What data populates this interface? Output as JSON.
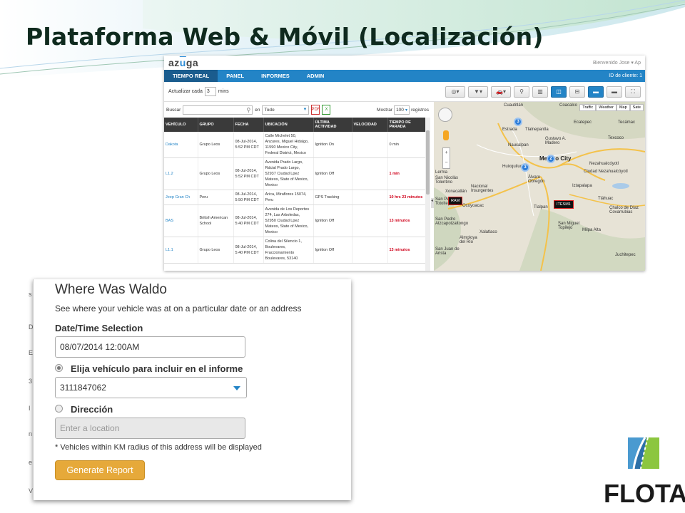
{
  "slide": {
    "title": "Plataforma Web & Móvil (Localización)"
  },
  "app": {
    "logo": "azuga",
    "welcome": "Bienvenido Jose ▾   Ap",
    "nav": [
      "TIEMPO REAL",
      "PANEL",
      "INFORMES",
      "ADMIN"
    ],
    "client_label": "ID de cliente: 1",
    "refresh": {
      "label": "Actualizar cada",
      "value": "3",
      "unit": "mins"
    },
    "search": {
      "label": "Buscar",
      "in_label": "en",
      "scope": "Todo",
      "show_label": "Mostrar",
      "show_value": "100",
      "records_label": "registros"
    },
    "table": {
      "headers": [
        "VEHÍCULO",
        "GRUPO",
        "FECHA",
        "UBICACIÓN",
        "ÚLTIMA ACTIVIDAD",
        "VELOCIDAD",
        "TIEMPO DE PARADA"
      ],
      "rows": [
        {
          "vehicle": "Dakota",
          "group": "Grupo Leos",
          "date": "08-Jul-2014, 5:52 PM CDT",
          "location": "Calle Michelet 50, Anzures, Miguel Hidalgo, 11590 Mexico City, Federal District, Mexico",
          "activity": "Ignition On",
          "speed": "",
          "stop": "0 min",
          "stop_red": false
        },
        {
          "vehicle": "L1.2",
          "group": "Grupo Leos",
          "date": "08-Jul-2014, 5:52 PM CDT",
          "location": "Avenida Prado Largo, Rdcial Prado Largo, 52937 Ciudad Lpez Mateos, State of Mexico, Mexico",
          "activity": "Ignition Off",
          "speed": "",
          "stop": "1 min",
          "stop_red": true
        },
        {
          "vehicle": "Jeep Gran Ch",
          "group": "Peru",
          "date": "08-Jul-2014, 5:50 PM CDT",
          "location": "Arica, Miraflores 15074, Peru",
          "activity": "GPS Tracking",
          "speed": "",
          "stop": "10 hrs 23 minutos",
          "stop_red": true
        },
        {
          "vehicle": "BAS",
          "group": "British American School",
          "date": "08-Jul-2014, 5:40 PM CDT",
          "location": "Avenida de Los Deportes 274, Las Arboledas, 52950 Ciudad Lpez Mateos, State of Mexico, Mexico",
          "activity": "Ignition Off",
          "speed": "",
          "stop": "13 minutos",
          "stop_red": true
        },
        {
          "vehicle": "L1.1",
          "group": "Grupo Leos",
          "date": "08-Jul-2014, 5:40 PM CDT",
          "location": "Colina del Silencio 1, Boulevares, Fraccionamiento Boulevares, 53140",
          "activity": "Ignition Off",
          "speed": "",
          "stop": "13 minutos",
          "stop_red": true
        }
      ]
    },
    "map": {
      "types": [
        "Traffic",
        "Weather",
        "Map",
        "Sate"
      ],
      "labels": [
        "Cuautitlán",
        "Coacalco",
        "Tlalnepantla",
        "Ecatepec",
        "Tecámac",
        "Gustavo A. Madero",
        "Naucalpan",
        "Texcoco",
        "Mexico City",
        "Nezahualcóyotl",
        "Ciudad Nezahualcóyotl",
        "Huixquilucan",
        "Álvaro Obregón",
        "Iztapalapa",
        "San Nicolás Tolentino",
        "Xonacatlán",
        "San Pedro Totoltepec",
        "Ocoyoacac",
        "Tláhuac",
        "Chalco de Díaz Covarrubias",
        "Tlalpan",
        "San Miguel Topilejo",
        "San Pedro Atzcapotzaltongo",
        "Xalatlaco",
        "Milpa Alta",
        "Almoloya del Río",
        "San Juan de Arista",
        "Juchitepec",
        "Lerma",
        "Estrada",
        "Nacional Insurgentes"
      ],
      "clusters": [
        "3",
        "2",
        "3"
      ],
      "vehicle_tags": [
        "RAM",
        "ITESM1"
      ]
    }
  },
  "waldo": {
    "title": "Where Was Waldo",
    "subtitle": "See where your vehicle was at on a particular date or an address",
    "datetime_label": "Date/Time Selection",
    "datetime_value": "08/07/2014 12:00AM",
    "vehicle_label": "Elija vehículo para incluir en el informe",
    "vehicle_value": "3111847062",
    "address_label": "Dirección",
    "address_placeholder": "Enter a location",
    "note": "* Vehicles within KM radius of this address will be displayed",
    "button": "Generate Report",
    "edge_chars": [
      "s",
      "D",
      "E",
      "3",
      "I",
      "n",
      "e",
      "V"
    ]
  },
  "brand": {
    "name": "FLOTA"
  }
}
